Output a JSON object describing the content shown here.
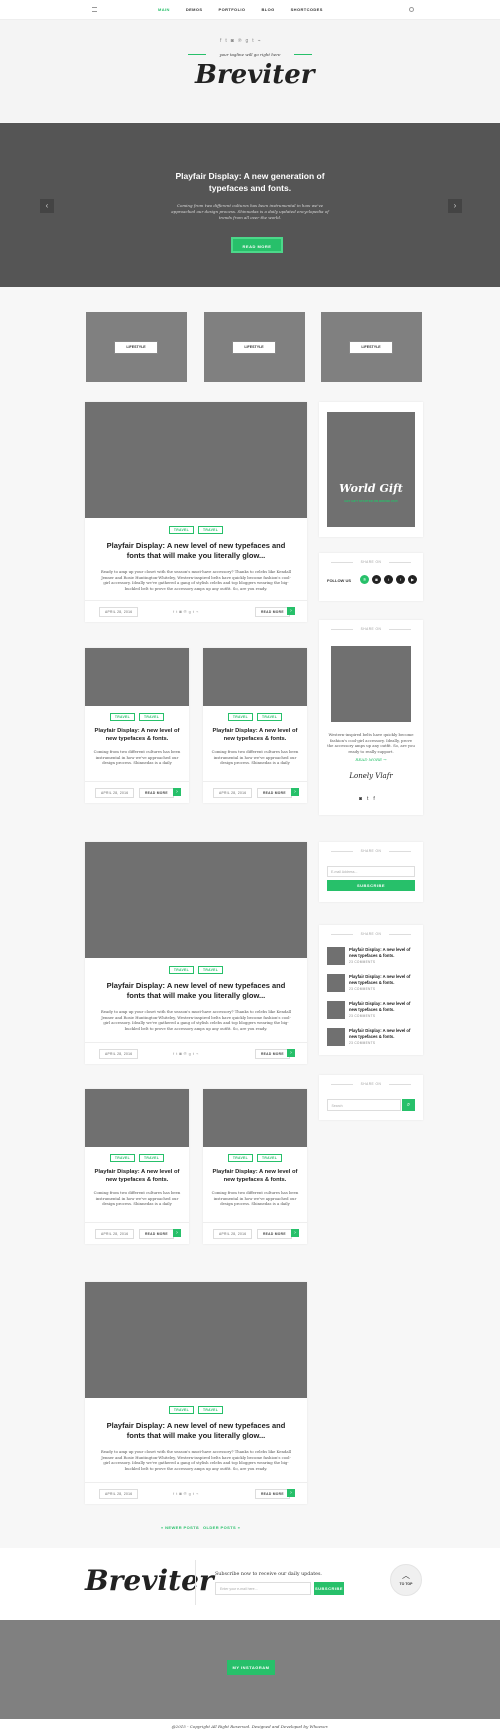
{
  "nav": {
    "items": [
      "MAIN",
      "DEMOS",
      "PORTFOLIO",
      "BLOG",
      "SHORTCODES"
    ]
  },
  "header": {
    "social": [
      "f",
      "t",
      "◙",
      "℗",
      "g",
      "t",
      "⌁"
    ],
    "tagline": "your tagline will go right here",
    "logo": "Breviter"
  },
  "slider": {
    "title": "Playfair Display: A new generation of typefaces and fonts.",
    "desc": "Coming from two different cultures has been instrumental in how we've approached our design process. Shinnedas is a daily updated encyclopedia of trends from all over the world.",
    "button": "READ MORE",
    "prev": "‹",
    "next": "›"
  },
  "categories": [
    "LIFESTYLE",
    "LIFESTYLE",
    "LIFESTYLE"
  ],
  "big_posts": [
    {
      "tags": [
        "TRAVEL",
        "TRAVEL"
      ],
      "title": "Playfair Display: A new level of new typefaces and fonts that will make you literally glow...",
      "desc": "Ready to amp up your closet with the season's must-have accessory? Thanks to celebs like Kendall Jenner and Rosie Huntington-Whiteley, Western-inspired belts have quickly become fashion's cool-girl accessory. Ideally we've gathered a gang of stylish celebs and top bloggers wearing the big-buckled belt to prove the accessory amps up any outfit. So, are you ready.",
      "date": "APRIL 28, 2016",
      "more": "READ MORE"
    },
    {
      "tags": [
        "TRAVEL",
        "TRAVEL"
      ],
      "title": "Playfair Display: A new level of new typefaces and fonts that will make you literally glow...",
      "desc": "Ready to amp up your closet with the season's must-have accessory? Thanks to celebs like Kendall Jenner and Rosie Huntington-Whiteley, Western-inspired belts have quickly become fashion's cool-girl accessory. Ideally we've gathered a gang of stylish celebs and top bloggers wearing the big-buckled belt to prove the accessory amps up any outfit. So, are you ready.",
      "date": "APRIL 28, 2016",
      "more": "READ MORE"
    },
    {
      "tags": [
        "TRAVEL",
        "TRAVEL"
      ],
      "title": "Playfair Display: A new level of new typefaces and fonts that will make you literally glow...",
      "desc": "Ready to amp up your closet with the season's must-have accessory? Thanks to celebs like Kendall Jenner and Rosie Huntington-Whiteley, Western-inspired belts have quickly become fashion's cool-girl accessory. Ideally we've gathered a gang of stylish celebs and top bloggers wearing the big-buckled belt to prove the accessory amps up any outfit. So, are you ready.",
      "date": "APRIL 28, 2016",
      "more": "READ MORE"
    }
  ],
  "small_posts": [
    {
      "tags": [
        "TRAVEL",
        "TRAVEL"
      ],
      "title": "Playfair Display: A new level of new typefaces & fonts.",
      "desc": "Coming from two different cultures has been instrumental in how we've approached our design process. Shinnedas is a daily",
      "date": "APRIL 28, 2016",
      "more": "READ MORE"
    },
    {
      "tags": [
        "TRAVEL",
        "TRAVEL"
      ],
      "title": "Playfair Display: A new level of new typefaces & fonts.",
      "desc": "Coming from two different cultures has been instrumental in how we've approached our design process. Shinnedas is a daily",
      "date": "APRIL 28, 2016",
      "more": "READ MORE"
    },
    {
      "tags": [
        "TRAVEL",
        "TRAVEL"
      ],
      "title": "Playfair Display: A new level of new typefaces & fonts.",
      "desc": "Coming from two different cultures has been instrumental in how we've approached our design process. Shinnedas is a daily",
      "date": "APRIL 28, 2016",
      "more": "READ MORE"
    },
    {
      "tags": [
        "TRAVEL",
        "TRAVEL"
      ],
      "title": "Playfair Display: A new level of new typefaces & fonts.",
      "desc": "Coming from two different cultures has been instrumental in how we've approached our design process. Shinnedas is a daily",
      "date": "APRIL 28, 2016",
      "more": "READ MORE"
    }
  ],
  "sidebar": {
    "ad_title": "World Gift",
    "ad_sub": "GET GIFT STARTED ON BREWE 2015",
    "follow_title": "SHARE ON",
    "follow_label": "FOLLOW US",
    "about_title": "SHARE ON",
    "about_text": "Western-inspired belts have quickly become fashion's cool-girl accessory. Ideally, prove the accessory amps up any outfit. So, are you ready to really support.",
    "about_more": "READ MORE →",
    "signature": "Lonely Vlafr",
    "newsletter_title": "SHARE ON",
    "newsletter_placeholder": "E-mail Address...",
    "newsletter_button": "SUBSCRIBE",
    "recent_title": "SHARE ON",
    "recent": [
      {
        "title": "Playfair Display: A new level of new typefaces & fonts.",
        "comments": "23 COMMENTS"
      },
      {
        "title": "Playfair Display: A new level of new typefaces & fonts.",
        "comments": "23 COMMENTS"
      },
      {
        "title": "Playfair Display: A new level of new typefaces & fonts.",
        "comments": "23 COMMENTS"
      },
      {
        "title": "Playfair Display: A new level of new typefaces & fonts.",
        "comments": "23 COMMENTS"
      }
    ],
    "search_title": "SHARE ON",
    "search_placeholder": "Search"
  },
  "pagination": {
    "newer": "« NEWER POSTS",
    "separator": "/",
    "older": "OLDER POSTS »"
  },
  "footer": {
    "logo": "Breviter",
    "subscribe_text": "Subscribe now to receive our daily updates.",
    "input_placeholder": "Enter your e-mail here...",
    "subscribe_button": "SUBSCRIBE",
    "totop": "TO TOP",
    "instagram_button": "MY INSTAGRAM",
    "copyright": "@2015 - Copyright All Right Reserved. Designed and Developed by Whoever."
  },
  "colors": {
    "accent": "#27c06a",
    "placeholder": "#707070",
    "slider": "#555555"
  }
}
